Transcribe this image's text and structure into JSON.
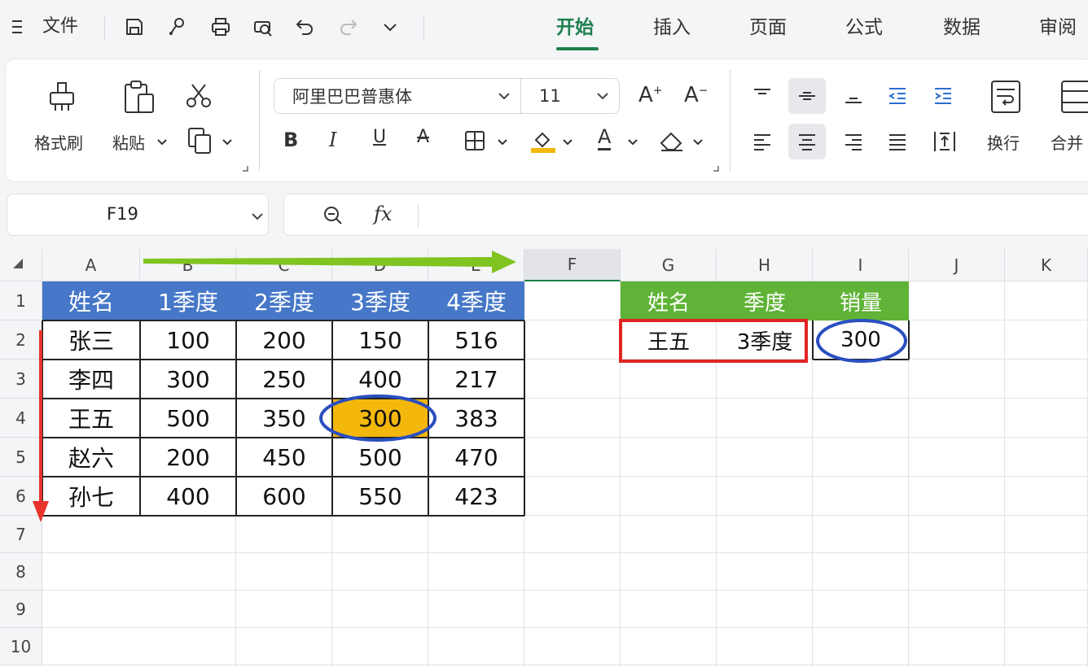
{
  "menubar": {
    "menu_label": "文件",
    "tabs": [
      {
        "label": "开始",
        "active": true
      },
      {
        "label": "插入",
        "active": false
      },
      {
        "label": "页面",
        "active": false
      },
      {
        "label": "公式",
        "active": false
      },
      {
        "label": "数据",
        "active": false
      },
      {
        "label": "审阅",
        "active": false
      }
    ]
  },
  "ribbon": {
    "format_painter": "格式刷",
    "paste": "粘贴",
    "font_name": "阿里巴巴普惠体",
    "font_size": "11",
    "bold": "B",
    "italic": "I",
    "underline": "U",
    "strikethrough": "A",
    "font_color_letter": "A",
    "increase_font": "A",
    "decrease_font": "A",
    "wrap": "换行",
    "merge": "合并"
  },
  "formula_bar": {
    "name_box": "F19",
    "fx": "fx",
    "formula": ""
  },
  "grid": {
    "columns": [
      "A",
      "B",
      "C",
      "D",
      "E",
      "F",
      "G",
      "H",
      "I",
      "J",
      "K"
    ],
    "rows": [
      "1",
      "2",
      "3",
      "4",
      "5",
      "6",
      "7",
      "8",
      "9",
      "10"
    ],
    "selected_column": "F"
  },
  "main_table": {
    "headers": [
      "姓名",
      "1季度",
      "2季度",
      "3季度",
      "4季度"
    ],
    "rows": [
      [
        "张三",
        "100",
        "200",
        "150",
        "516"
      ],
      [
        "李四",
        "300",
        "250",
        "400",
        "217"
      ],
      [
        "王五",
        "500",
        "350",
        "300",
        "383"
      ],
      [
        "赵六",
        "200",
        "450",
        "500",
        "470"
      ],
      [
        "孙七",
        "400",
        "600",
        "550",
        "423"
      ]
    ],
    "highlight_cell": "D4"
  },
  "lookup_table": {
    "headers": [
      "姓名",
      "季度",
      "销量"
    ],
    "row": [
      "王五",
      "3季度",
      "300"
    ]
  },
  "colors": {
    "active_tab": "#1e7f4d",
    "blue_header": "#4677c8",
    "green_header": "#5fb336",
    "highlight_fill": "#f4b70c",
    "circle_stroke": "#2a4fbf",
    "red_box": "#e02424",
    "red_arrow": "#e8322c",
    "green_arrow": "#7fc420"
  }
}
